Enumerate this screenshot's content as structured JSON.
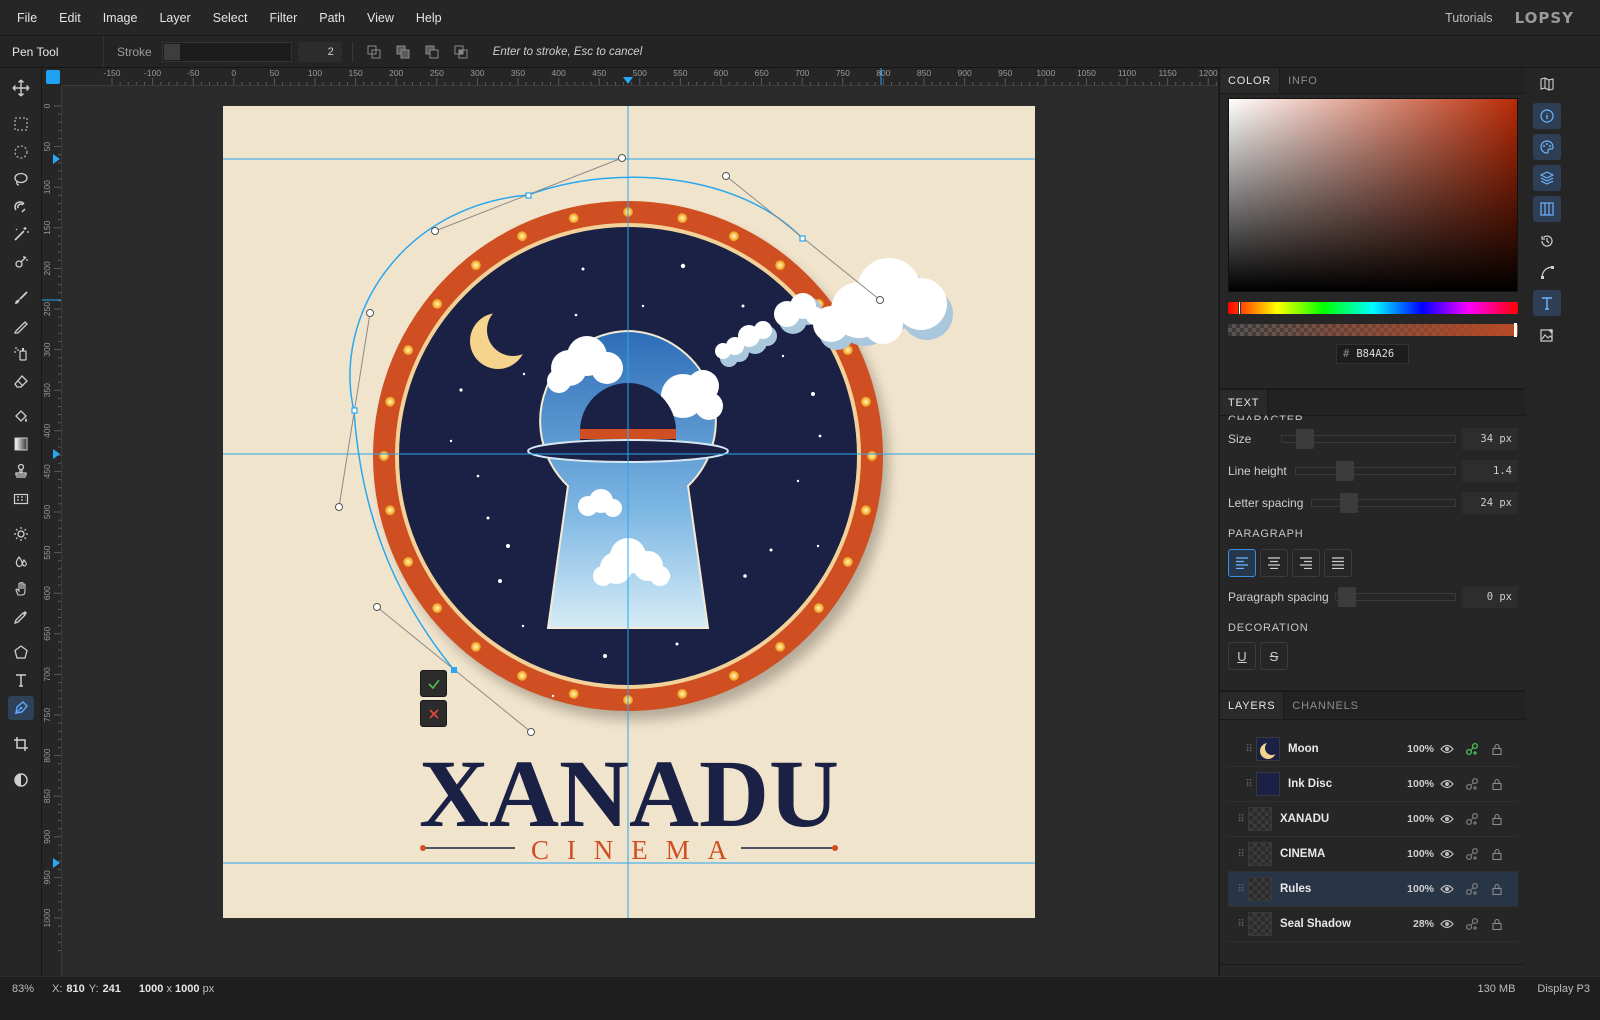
{
  "menu": {
    "items": [
      "File",
      "Edit",
      "Image",
      "Layer",
      "Select",
      "Filter",
      "Path",
      "View",
      "Help"
    ],
    "tutorials": "Tutorials",
    "logo": "LOPSY"
  },
  "options": {
    "tool_name": "Pen Tool",
    "stroke_label": "Stroke",
    "stroke_value": "2",
    "hint": "Enter to stroke, Esc to cancel"
  },
  "rulers": {
    "top_ticks": [
      "-150",
      "-100",
      "-50",
      "0",
      "50",
      "100",
      "150",
      "200",
      "250",
      "300",
      "350",
      "400",
      "450",
      "500",
      "550",
      "600",
      "650",
      "700",
      "750",
      "800",
      "850",
      "900",
      "950",
      "1000",
      "1050",
      "1100",
      "1150",
      "1200"
    ],
    "left_ticks": [
      "0",
      "50",
      "100",
      "150",
      "200",
      "250",
      "300",
      "350",
      "400",
      "450",
      "500",
      "550",
      "600",
      "650",
      "700",
      "750",
      "800",
      "850",
      "900",
      "950",
      "1000"
    ]
  },
  "artwork": {
    "title": "XANADU",
    "subtitle": "CINEMA"
  },
  "color_panel": {
    "tabs": [
      "COLOR",
      "INFO"
    ],
    "hex_hash": "#",
    "hex": "B84A26",
    "accent": "#b84a26"
  },
  "text_panel": {
    "tab": "TEXT",
    "section_character": "CHARACTER",
    "size_label": "Size",
    "size_value": "34 px",
    "line_height_label": "Line height",
    "line_height_value": "1.4",
    "letter_spacing_label": "Letter spacing",
    "letter_spacing_value": "24 px",
    "section_paragraph": "PARAGRAPH",
    "paragraph_spacing_label": "Paragraph spacing",
    "paragraph_spacing_value": "0 px",
    "section_decoration": "DECORATION",
    "underline": "U",
    "strike": "S"
  },
  "layers_panel": {
    "tabs": [
      "LAYERS",
      "CHANNELS"
    ],
    "layers": [
      {
        "name": "Moon",
        "opacity": "100%"
      },
      {
        "name": "Ink Disc",
        "opacity": "100%"
      },
      {
        "name": "XANADU",
        "opacity": "100%"
      },
      {
        "name": "CINEMA",
        "opacity": "100%"
      },
      {
        "name": "Rules",
        "opacity": "100%"
      },
      {
        "name": "Seal Shadow",
        "opacity": "28%"
      }
    ]
  },
  "status": {
    "zoom": "83%",
    "x_label": "X:",
    "x": "810",
    "y_label": "Y:",
    "y": "241",
    "dims_w": "1000",
    "dims_sep": "x",
    "dims_h": "1000",
    "dims_unit": "px",
    "memory": "130 MB",
    "profile": "Display P3"
  }
}
